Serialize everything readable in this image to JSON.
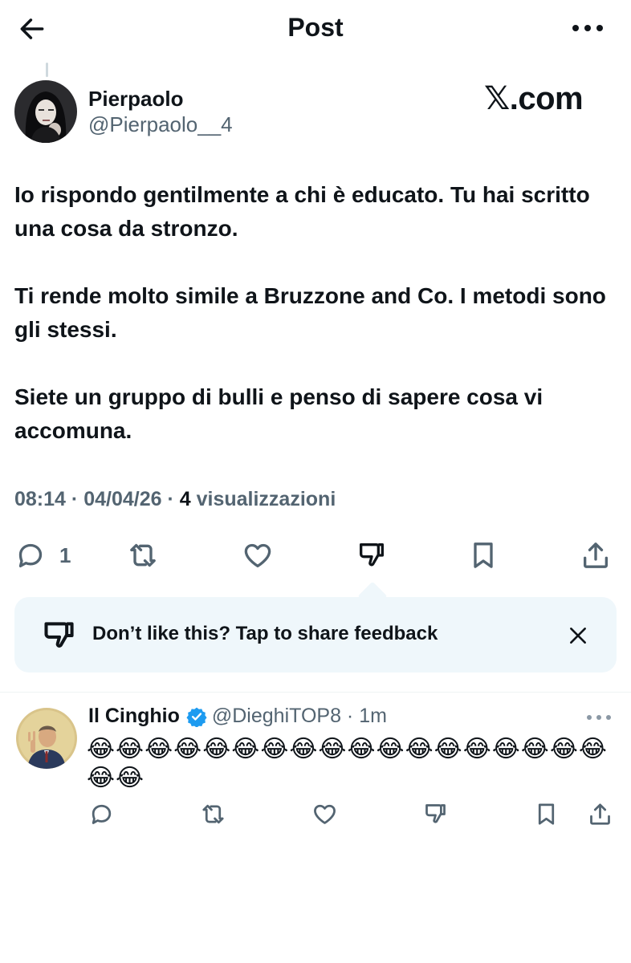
{
  "header": {
    "title": "Post",
    "back_icon": "arrow-left-icon",
    "more_icon": "more-horizontal-icon"
  },
  "post": {
    "author_name": "Pierpaolo",
    "author_handle": "@Pierpaolo__4",
    "watermark": "𝕏.com",
    "paragraphs": [
      "Io rispondo gentilmente a chi è educato. Tu hai scritto una cosa da stronzo.",
      "Ti rende molto simile a Bruzzone and Co.  I metodi sono gli stessi.",
      "Siete un gruppo di bulli e penso di sapere cosa vi accomuna."
    ],
    "time": "08:14",
    "date": "04/04/26",
    "views_count": "4",
    "views_label": "visualizzazioni",
    "reply_count": "1"
  },
  "feedback": {
    "text": "Don’t like this? Tap to share feedback",
    "icon": "thumbs-down-icon",
    "close_icon": "close-icon"
  },
  "reply": {
    "author_name": "Il Cinghio",
    "author_handle": "@DieghiTOP8",
    "time": "1m",
    "text": "😂😂😂😂😂😂😂😂😂😂😂😂😂😂😂😂😂😂😂😂",
    "verified_icon": "verified-badge-icon"
  },
  "colors": {
    "text": "#0f1419",
    "secondary": "#536471",
    "verified": "#1d9bf0",
    "feedback_bg": "#eff7fb"
  }
}
